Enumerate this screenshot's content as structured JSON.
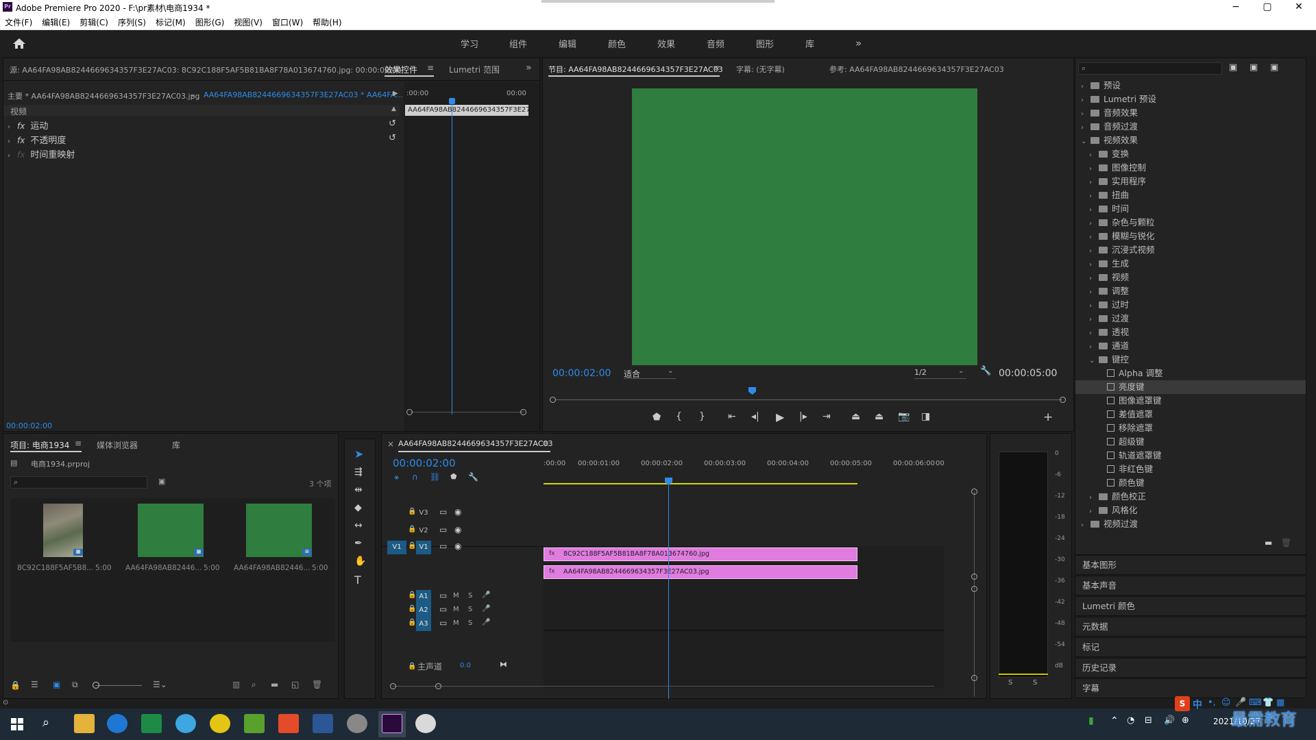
{
  "window": {
    "title": "Adobe Premiere Pro 2020 - F:\\pr素材\\电商1934 *",
    "app_badge": "Pr",
    "minimize": "−",
    "maximize": "▢",
    "close": "✕"
  },
  "menu": [
    "文件(F)",
    "编辑(E)",
    "剪辑(C)",
    "序列(S)",
    "标记(M)",
    "图形(G)",
    "视图(V)",
    "窗口(W)",
    "帮助(H)"
  ],
  "workspaces": [
    "学习",
    "组件",
    "编辑",
    "颜色",
    "效果",
    "音频",
    "图形",
    "库"
  ],
  "source_panel": {
    "tab_source": "源: AA64FA98AB8244669634357F3E27AC03: 8C92C188F5AF5B81BA8F78A013674760.jpg: 00:00:00:00",
    "tab_effect_controls": "效果控件",
    "tab_lumetri_scopes": "Lumetri 范围",
    "master_clip": "主要 * AA64FA98AB8244669634357F3E27AC03.jpg",
    "sequence_clip": "AA64FA98AB8244669634357F3E27AC03 * AA64FA...",
    "section_video": "视频",
    "effects": [
      "运动",
      "不透明度",
      "时间重映射"
    ],
    "ruler_start": ":00:00",
    "ruler_end": "00:00",
    "clip_label": "AA64FA98AB8244669634357F3E27",
    "timecode": "00:00:02:00"
  },
  "program_monitor": {
    "tab_program": "节目: AA64FA98AB8244669634357F3E27AC03",
    "tab_captions": "字幕: (无字幕)",
    "tab_reference": "参考: AA64FA98AB8244669634357F3E27AC03",
    "current_time": "00:00:02:00",
    "fit": "适合",
    "resolution": "1/2",
    "duration": "00:00:05:00",
    "frame_color": "#2f7d3f"
  },
  "project_panel": {
    "tab_project": "项目: 电商1934",
    "tab_media_browser": "媒体浏览器",
    "tab_library": "库",
    "project_file": "电商1934.prproj",
    "item_count": "3 个项",
    "items": [
      {
        "name": "8C92C188F5AF5B8...",
        "duration": "5:00"
      },
      {
        "name": "AA64FA98AB82446...",
        "duration": "5:00"
      },
      {
        "name": "AA64FA98AB82446...",
        "duration": "5:00"
      }
    ]
  },
  "timeline": {
    "sequence_name": "AA64FA98AB8244669634357F3E27AC03",
    "current_time": "00:00:02:00",
    "ruler": [
      ":00:00",
      "00:00:01:00",
      "00:00:02:00",
      "00:00:03:00",
      "00:00:04:00",
      "00:00:05:00",
      "00:00:06:00",
      "00"
    ],
    "video_tracks": [
      "V3",
      "V2",
      "V1"
    ],
    "source_patch": "V1",
    "audio_tracks": [
      "A1",
      "A2",
      "A3"
    ],
    "mute": "M",
    "solo": "S",
    "master": "主声道",
    "master_value": "0.0",
    "clips": [
      {
        "track": "V2",
        "name": "8C92C188F5AF5B81BA8F78A013674760.jpg"
      },
      {
        "track": "V1",
        "name": "AA64FA98AB8244669634357F3E27AC03.jpg"
      }
    ],
    "clip_color": "#e07be0"
  },
  "audio_meter": {
    "scale": [
      "0",
      "-6",
      "-12",
      "-18",
      "-24",
      "-30",
      "-36",
      "-42",
      "-48",
      "-54",
      "dB"
    ],
    "solo_left": "S",
    "solo_right": "S"
  },
  "effects_panel": {
    "tree": [
      {
        "label": "预设",
        "level": 0,
        "open": false
      },
      {
        "label": "Lumetri 预设",
        "level": 0,
        "open": false
      },
      {
        "label": "音频效果",
        "level": 0,
        "open": false
      },
      {
        "label": "音频过渡",
        "level": 0,
        "open": false
      },
      {
        "label": "视频效果",
        "level": 0,
        "open": true
      },
      {
        "label": "变换",
        "level": 1,
        "open": false
      },
      {
        "label": "图像控制",
        "level": 1,
        "open": false
      },
      {
        "label": "实用程序",
        "level": 1,
        "open": false
      },
      {
        "label": "扭曲",
        "level": 1,
        "open": false
      },
      {
        "label": "时间",
        "level": 1,
        "open": false
      },
      {
        "label": "杂色与颗粒",
        "level": 1,
        "open": false
      },
      {
        "label": "模糊与锐化",
        "level": 1,
        "open": false
      },
      {
        "label": "沉浸式视频",
        "level": 1,
        "open": false
      },
      {
        "label": "生成",
        "level": 1,
        "open": false
      },
      {
        "label": "视频",
        "level": 1,
        "open": false
      },
      {
        "label": "调整",
        "level": 1,
        "open": false
      },
      {
        "label": "过时",
        "level": 1,
        "open": false
      },
      {
        "label": "过渡",
        "level": 1,
        "open": false
      },
      {
        "label": "透视",
        "level": 1,
        "open": false
      },
      {
        "label": "通道",
        "level": 1,
        "open": false
      },
      {
        "label": "键控",
        "level": 1,
        "open": true
      },
      {
        "label": "Alpha 调整",
        "level": 2,
        "open": false
      },
      {
        "label": "亮度键",
        "level": 2,
        "open": false,
        "selected": true
      },
      {
        "label": "图像遮罩键",
        "level": 2,
        "open": false
      },
      {
        "label": "差值遮罩",
        "level": 2,
        "open": false
      },
      {
        "label": "移除遮罩",
        "level": 2,
        "open": false
      },
      {
        "label": "超级键",
        "level": 2,
        "open": false
      },
      {
        "label": "轨道遮罩键",
        "level": 2,
        "open": false
      },
      {
        "label": "非红色键",
        "level": 2,
        "open": false
      },
      {
        "label": "颜色键",
        "level": 2,
        "open": false
      },
      {
        "label": "颜色校正",
        "level": 1,
        "open": false
      },
      {
        "label": "风格化",
        "level": 1,
        "open": false
      },
      {
        "label": "视频过渡",
        "level": 0,
        "open": false
      }
    ],
    "collapsed_panels": [
      "基本图形",
      "基本声音",
      "Lumetri 颜色",
      "元数据",
      "标记",
      "历史记录",
      "字幕"
    ]
  },
  "taskbar": {
    "date": "2021/10/27",
    "watermark": "最需教育",
    "ime": "中"
  }
}
